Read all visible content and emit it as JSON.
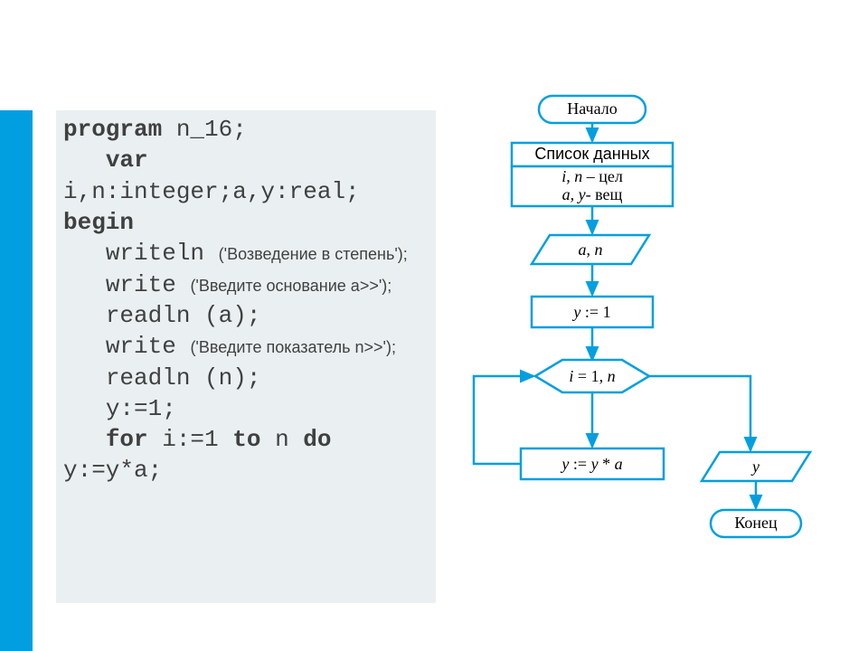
{
  "code": {
    "l1a": "program",
    "l1b": " n_16;",
    "l2a": "   var",
    "l3": "i,n:integer;a,y:real;",
    "l4": "begin",
    "l5a": "   writeln ",
    "l5b": "('Возведение в степень');",
    "l6a": "   write ",
    "l6b": "('Введите основание a",
    "l6c": ">>');",
    "l7": "   readln (a);",
    "l8a": "   write ",
    "l8b": "('Введите показатель n",
    "l8c": ">>');",
    "l9": "   readln (n);",
    "l10": "   y:=1;",
    "l11a": "   for",
    "l11b": " i:=1 ",
    "l11c": "to",
    "l11d": " n ",
    "l11e": "do",
    "l12": "y:=y*a;"
  },
  "flow": {
    "start": "Начало",
    "datahdr": "Список данных",
    "datavars_a": "i, n",
    "datavars_b": " – цел",
    "datavars_c": "a, y",
    "datavars_d": "- вещ",
    "io1": "a, n",
    "proc1": "y := 1",
    "loop": "i = 1, n",
    "proc2": "y := y * a",
    "io2": "y",
    "end": "Конец"
  },
  "colors": {
    "stroke": "#029fe0",
    "text": "#000"
  }
}
